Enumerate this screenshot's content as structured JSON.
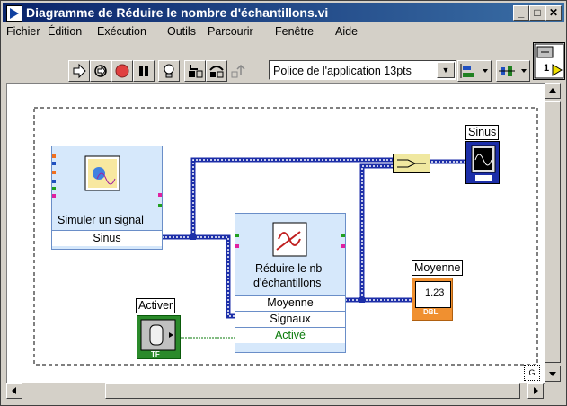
{
  "window": {
    "title": "Diagramme de Réduire le nombre d'échantillons.vi"
  },
  "menu": [
    "Fichier",
    "Édition",
    "Exécution",
    "Outils",
    "Parcourir",
    "Fenêtre",
    "Aide"
  ],
  "toolbar": {
    "font_selector": "Police de l'application 13pts",
    "connector_label": "1"
  },
  "diagram": {
    "simulate_node": {
      "label": "Simuler un signal",
      "terminal": "Sinus"
    },
    "reduce_node": {
      "label_line1": "Réduire le nb",
      "label_line2": "d'échantillons",
      "terminals": [
        "Moyenne",
        "Signaux",
        "Activé"
      ]
    },
    "sinus_indicator": {
      "label": "Sinus"
    },
    "moyenne_indicator": {
      "label": "Moyenne",
      "value": "1.23",
      "type": "DBL"
    },
    "activer_control": {
      "label": "Activer",
      "type": "TF"
    },
    "loop_corner": "G"
  },
  "colors": {
    "wire_dynamic": "#1c2ea8",
    "wire_bool": "#0a7a0a",
    "node_bg": "#d6e8fb",
    "title_bg": "#0a246a",
    "dbl_orange": "#f09030",
    "bool_green": "#2a8a2a"
  }
}
